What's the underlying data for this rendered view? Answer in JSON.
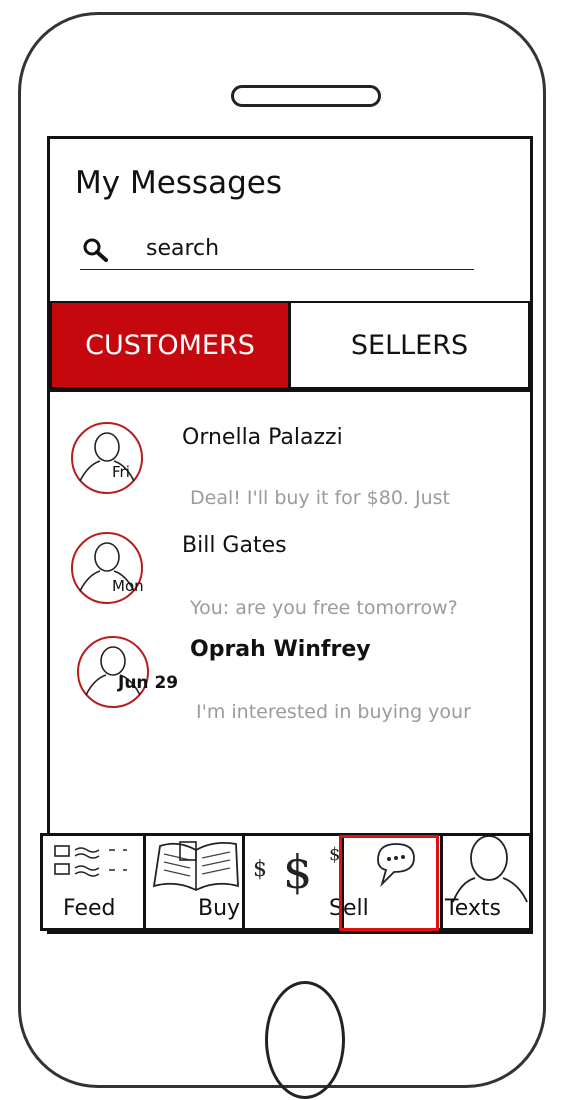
{
  "header": {
    "title": "My Messages"
  },
  "search": {
    "text": "search"
  },
  "tabs": [
    {
      "label": "CUSTOMERS",
      "active": true
    },
    {
      "label": "SELLERS",
      "active": false
    }
  ],
  "conversations": [
    {
      "name": "Ornella Palazzi",
      "day": "Fri",
      "preview": "Deal! I'll buy it for $80. Just"
    },
    {
      "name": "Bill Gates",
      "day": "Mon",
      "preview": "You: are you free tomorrow?"
    },
    {
      "name": "Oprah Winfrey",
      "day": "Jun 29",
      "preview": "I'm interested in buying your"
    }
  ],
  "nav": [
    {
      "label": "Feed",
      "icon": "list-icon"
    },
    {
      "label": "Buy",
      "icon": "book-icon"
    },
    {
      "label": "Sell",
      "icon": "dollar-icon"
    },
    {
      "label": "Texts",
      "icon": "person-icon"
    }
  ],
  "colors": {
    "accent": "#c4080d",
    "preview_text": "#9b9b9b",
    "sell_highlight": "#dd1111"
  }
}
